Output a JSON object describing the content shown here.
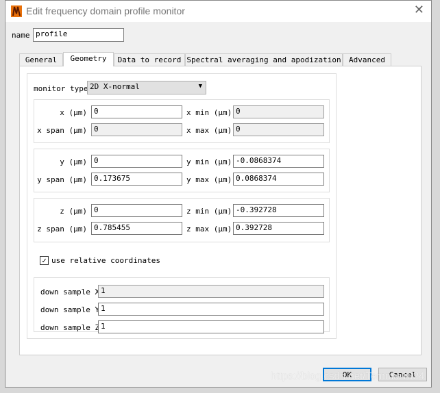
{
  "window": {
    "title": "Edit frequency domain profile monitor",
    "close": "✕"
  },
  "name": {
    "label": "name",
    "value": "profile"
  },
  "tabs": [
    "General",
    "Geometry",
    "Data to record",
    "Spectral averaging and apodization",
    "Advanced"
  ],
  "monitor_type": {
    "label": "monitor type",
    "value": "2D X-normal"
  },
  "x": {
    "pos_label": "x (μm)",
    "pos": "0",
    "min_label": "x min (μm)",
    "min": "0",
    "span_label": "x span (μm)",
    "span": "0",
    "max_label": "x max (μm)",
    "max": "0"
  },
  "y": {
    "pos_label": "y (μm)",
    "pos": "0",
    "min_label": "y min (μm)",
    "min": "-0.0868374",
    "span_label": "y span (μm)",
    "span": "0.173675",
    "max_label": "y max (μm)",
    "max": "0.0868374"
  },
  "z": {
    "pos_label": "z (μm)",
    "pos": "0",
    "min_label": "z min (μm)",
    "min": "-0.392728",
    "span_label": "z span (μm)",
    "span": "0.785455",
    "max_label": "z max (μm)",
    "max": "0.392728"
  },
  "relative": {
    "label": "use relative coordinates",
    "checked": true
  },
  "downsample": [
    {
      "label": "down sample X",
      "value": "1"
    },
    {
      "label": "down sample Y",
      "value": "1"
    },
    {
      "label": "down sample Z",
      "value": "1"
    }
  ],
  "buttons": {
    "ok": "OK",
    "cancel": "Cancel"
  },
  "watermark": "https://blog.csdn.net/Temmie1024"
}
